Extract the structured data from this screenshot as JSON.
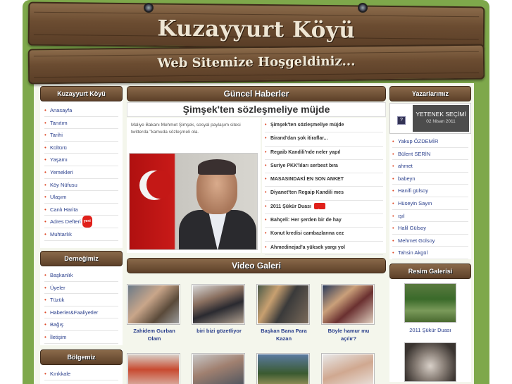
{
  "header": {
    "site_title": "Kuzayyurt Köyü",
    "welcome": "Web Sitemize Hoşgeldiniz..."
  },
  "left": {
    "village_box": {
      "title": "Kuzayyurt Köyü",
      "items": [
        "Anasayfa",
        "Tanıtım",
        "Tarihi",
        "Kültürü",
        "Yaşamı",
        "Yemekleri",
        "Köy Nüfusu",
        "Ulaşım",
        "Canlı Harita",
        "Adres Defteri",
        "Muhtarlık"
      ],
      "new_badge": "yeni"
    },
    "association_box": {
      "title": "Derneğimiz",
      "items": [
        "Başkanlık",
        "Üyeler",
        "Tüzük",
        "Haberler&Faaliyetler",
        "Bağış",
        "İletişim"
      ]
    },
    "region_box": {
      "title": "Bölgemiz",
      "items": [
        "Kırıkkale"
      ]
    }
  },
  "center": {
    "news_heading": "Güncel Haberler",
    "featured_title": "Şimşek'ten sözleşmeliye müjde",
    "featured_summary": "Maliye Bakanı Mehmet Şimşek, sosyal paylaşım sitesi twitterda \"kamuda sözleşmeli ola.",
    "headlines": [
      "Şimşek'ten sözleşmeliye müjde",
      "Birand'dan şok itiraflar...",
      "Regaib Kandili'nde neler yapıl",
      "Suriye PKK'lıları serbest bıra",
      "MASASINDAKİ EN SON ANKET",
      "Diyanet'ten Regaip Kandili mes",
      "2011 Şükür Duası",
      "Bahçeli: Her şerden bir de hay",
      "Konut kredisi cambazlarına cez",
      "Ahmedinejad'a yüksek yargı yol"
    ],
    "video_heading": "Video Galeri",
    "videos": [
      {
        "caption": "Zahidem Gurban Olam"
      },
      {
        "caption": "biri bizi gözetliyor"
      },
      {
        "caption": "Başkan Bana Para Kazan"
      },
      {
        "caption": "Böyle hamur mu açılır?"
      }
    ]
  },
  "right": {
    "authors_heading": "Yazarlarımız",
    "featured_author": "YETENEK SEÇİMİ",
    "featured_date": "02 Nisan 2011",
    "authors": [
      "Yakup ÖZDEMİR",
      "Bülent SERİN",
      "ahmet",
      "babeyn",
      "Hanifi gülsoy",
      "Hüseyin Sayın",
      "ışıl",
      "Halil Gülsoy",
      "Mehmet Gülsoy",
      "Tahsin Akgül"
    ],
    "gallery_heading": "Resim Galerisi",
    "gallery_caption": "2011 Şükür Duası"
  },
  "colors": {
    "frame_green": "#7ea84b",
    "wood": "#6b4c31",
    "link_blue": "#2a3f8c",
    "bullet_red": "#dd4422"
  }
}
